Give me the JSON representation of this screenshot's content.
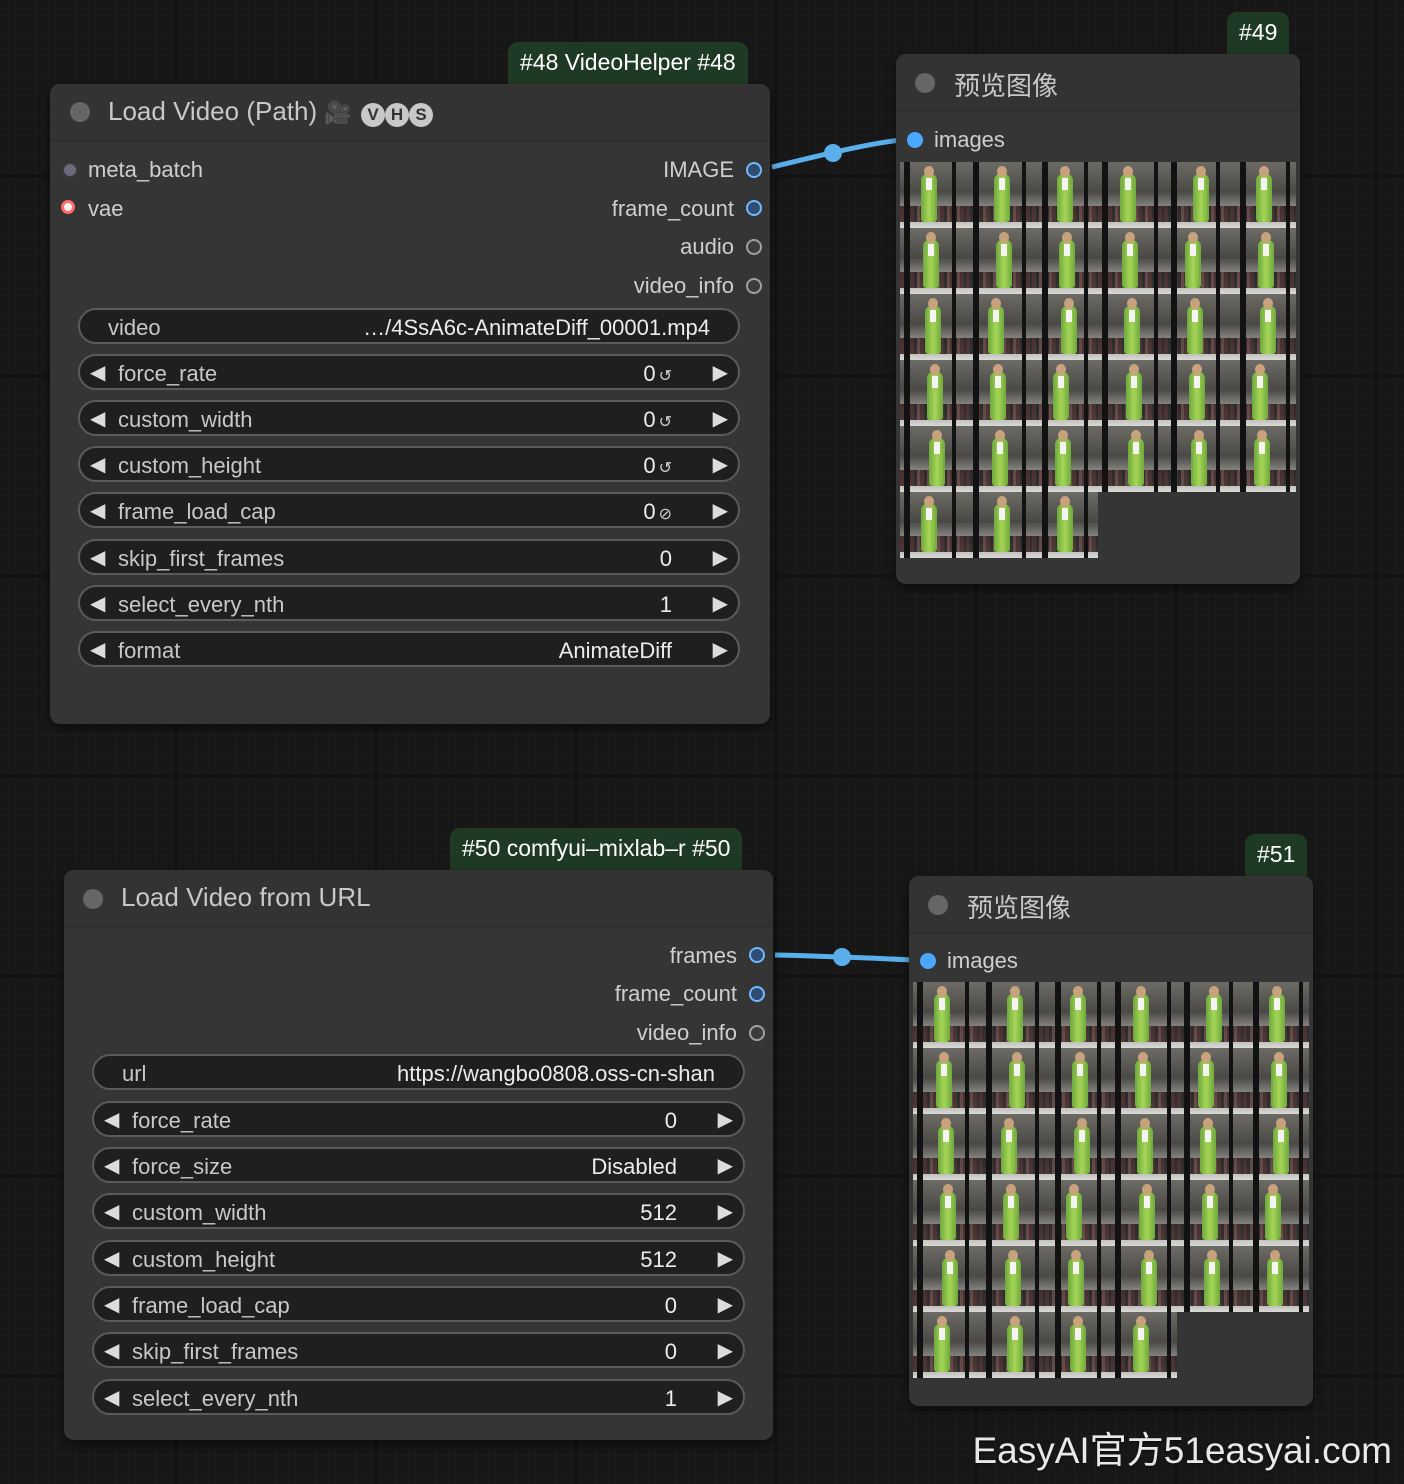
{
  "node48": {
    "badge": "#48 VideoHelper  #48",
    "title": "Load Video (Path)",
    "title_icon": "film-camera-icon",
    "title_tag": "VHS",
    "inputs": [
      {
        "label": "meta_batch",
        "color": "#6a6a7a"
      },
      {
        "label": "vae",
        "color": "#ff6b6b"
      }
    ],
    "outputs": [
      {
        "label": "IMAGE"
      },
      {
        "label": "frame_count"
      },
      {
        "label": "audio"
      },
      {
        "label": "video_info"
      }
    ],
    "widgets": [
      {
        "label": "video",
        "value": "…/4SsA6c-AnimateDiff_00001.mp4",
        "kind": "text"
      },
      {
        "label": "force_rate",
        "value": "0",
        "suffix": "↺"
      },
      {
        "label": "custom_width",
        "value": "0",
        "suffix": "↺"
      },
      {
        "label": "custom_height",
        "value": "0",
        "suffix": "↺"
      },
      {
        "label": "frame_load_cap",
        "value": "0",
        "suffix": "⊘"
      },
      {
        "label": "skip_first_frames",
        "value": "0"
      },
      {
        "label": "select_every_nth",
        "value": "1"
      },
      {
        "label": "format",
        "value": "AnimateDiff"
      }
    ]
  },
  "node49": {
    "badge": "#49",
    "title": "预览图像",
    "input_label": "images",
    "frame_count_shown": 33
  },
  "node50": {
    "badge": "#50 comfyui–mixlab–r  #50",
    "title": "Load Video from URL",
    "outputs": [
      {
        "label": "frames"
      },
      {
        "label": "frame_count"
      },
      {
        "label": "video_info"
      }
    ],
    "widgets": [
      {
        "label": "url",
        "value": "https://wangbo0808.oss-cn-shan",
        "kind": "text"
      },
      {
        "label": "force_rate",
        "value": "0"
      },
      {
        "label": "force_size",
        "value": "Disabled"
      },
      {
        "label": "custom_width",
        "value": "512"
      },
      {
        "label": "custom_height",
        "value": "512"
      },
      {
        "label": "frame_load_cap",
        "value": "0"
      },
      {
        "label": "skip_first_frames",
        "value": "0"
      },
      {
        "label": "select_every_nth",
        "value": "1"
      }
    ]
  },
  "node51": {
    "badge": "#51",
    "title": "预览图像",
    "input_label": "images",
    "frame_count_shown": 34
  },
  "watermark": "EasyAI官方51easyai.com",
  "colors": {
    "link": "#5aaeea",
    "badge_bg": "#1f3a24",
    "node_bg": "#353535",
    "widget_bg": "#1f1f1f"
  }
}
